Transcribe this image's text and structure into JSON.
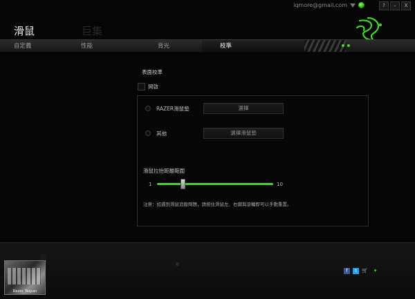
{
  "window": {
    "email": "iqmore@gmail.com",
    "buttons": [
      {
        "label": "?",
        "name": "help-button"
      },
      {
        "label": "–",
        "name": "minimize-button"
      },
      {
        "label": "X",
        "name": "close-button"
      }
    ]
  },
  "header": {
    "title": "滑鼠",
    "second_title": "巨集"
  },
  "tabs": [
    {
      "label": "自定義",
      "active": false
    },
    {
      "label": "性能",
      "active": false
    },
    {
      "label": "背光",
      "active": false
    },
    {
      "label": "校準",
      "active": true
    }
  ],
  "main": {
    "section_title": "表面校準",
    "enable_label": "開啟",
    "enable_checked": false,
    "options": [
      {
        "label": "RAZER滑鼠墊",
        "button": "選擇"
      },
      {
        "label": "其他",
        "button": "選擇滑鼠墊"
      }
    ],
    "slider": {
      "label": "滑鼠拉抬距離範圍",
      "min": "1",
      "max": "10",
      "value": 3
    },
    "note": "注意：如遇到滑鼠追蹤問題，請按住滑鼠左、右鍵與滾輪即可以手動重置。"
  },
  "footer": {
    "device_caption": "RAZER TAIPAN",
    "device_name": "Razer Taipan",
    "icons": [
      "facebook-icon",
      "twitter-icon",
      "cart-icon",
      "razer-icon"
    ]
  },
  "colors": {
    "accent": "#44d62c",
    "background": "#050505"
  }
}
